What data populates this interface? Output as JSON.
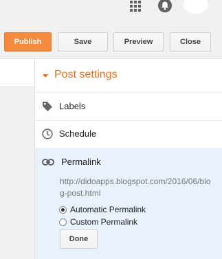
{
  "topbar": {
    "apps_icon": "apps-grid-icon",
    "notification_icon": "notification-bell-icon",
    "avatar_icon": "user-avatar"
  },
  "toolbar": {
    "publish_label": "Publish",
    "save_label": "Save",
    "preview_label": "Preview",
    "close_label": "Close"
  },
  "post_settings": {
    "title": "Post settings",
    "items": [
      {
        "label": "Labels",
        "icon": "tag-icon"
      },
      {
        "label": "Schedule",
        "icon": "clock-icon"
      }
    ],
    "permalink": {
      "label": "Permalink",
      "icon": "link-icon",
      "url": "http://didoapps.blogspot.com/2016/06/blog-post.html",
      "options": [
        {
          "label": "Automatic Permalink",
          "selected": true
        },
        {
          "label": "Custom Permalink",
          "selected": false
        }
      ],
      "done_label": "Done"
    }
  },
  "colors": {
    "accent": "#e5711d",
    "publish_button": "#f48b3e",
    "permalink_bg": "#e9f1fc"
  }
}
